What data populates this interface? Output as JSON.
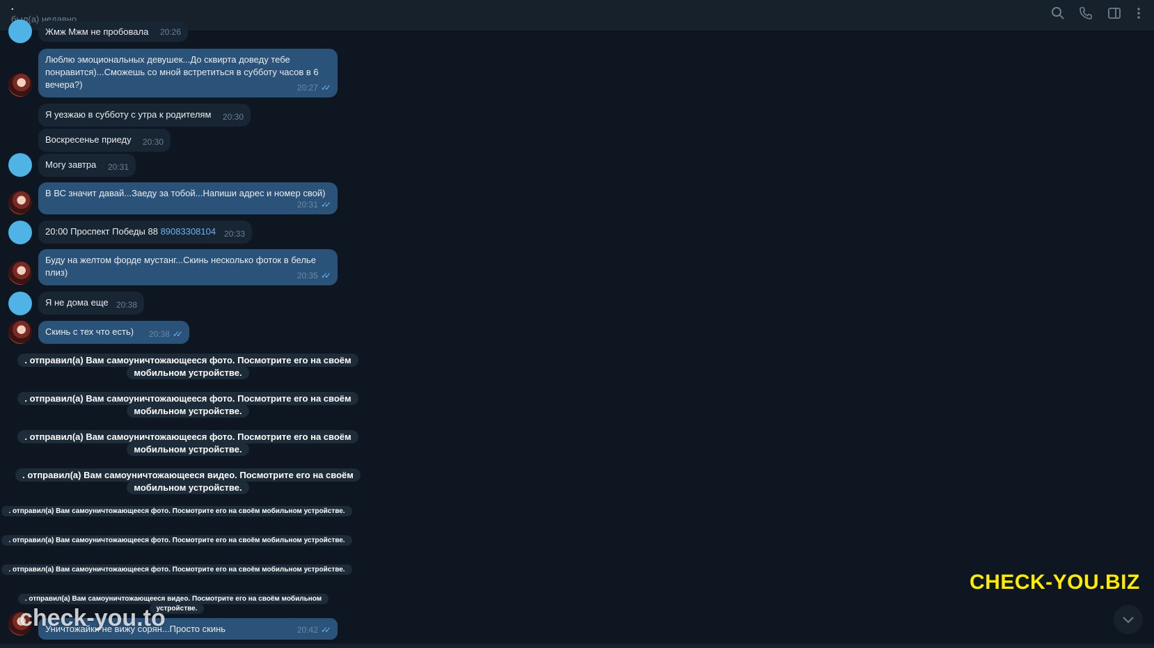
{
  "header": {
    "name": ".",
    "status": "был(а) недавно",
    "icons": [
      "search-icon",
      "phone-icon",
      "sidebar-toggle-icon",
      "more-vert-icon"
    ]
  },
  "messages": [
    {
      "text": "Жмж Мжм не пробовала",
      "time": "20:26",
      "dir": "in"
    },
    {
      "text": "Люблю эмоциональных девушек...До сквирта доведу тебе понравится)...Сможешь со мной встретиться в субботу часов в 6 вечера?)",
      "time": "20:27",
      "dir": "out"
    },
    {
      "text": "Я уезжаю в субботу с утра к родителям",
      "time": "20:30",
      "dir": "in"
    },
    {
      "text": "Воскресенье приеду",
      "time": "20:30",
      "dir": "in"
    },
    {
      "text": "Могу завтра",
      "time": "20:31",
      "dir": "in"
    },
    {
      "text": "В ВС значит давай...Заеду за тобой...Напиши адрес и номер свой)",
      "time": "20:31",
      "dir": "out"
    },
    {
      "text": "20:00  Проспект Победы 88",
      "phone": "89083308104",
      "time": "20:33",
      "dir": "in"
    },
    {
      "text": "Буду на желтом форде мустанг...Скинь несколько фоток в белье плиз)",
      "time": "20:35",
      "dir": "out"
    },
    {
      "text": "Я не дома еще",
      "time": "20:38",
      "dir": "in"
    },
    {
      "text": "Скинь с тех что есть)",
      "time": "20:38",
      "dir": "out"
    },
    {
      "text": "Уничтожайки не вижу сорян...Просто скинь",
      "time": "20:42",
      "dir": "out"
    }
  ],
  "service": {
    "photo": ". отправил(а) Вам самоуничтожающееся фото. Посмотрите его на своём мобильном устройстве.",
    "video": ". отправил(а) Вам самоуничтожающееся видео. Посмотрите его на своём мобильном устройстве."
  },
  "watermarks": {
    "top_right": "CHECK-YOU.BIZ",
    "bottom_left": "check-you.to"
  },
  "colors": {
    "background": "#0e1621",
    "header": "#17212b",
    "incoming": "#182533",
    "outgoing": "#2b5278",
    "accent": "#6ab3f3",
    "watermark_yellow": "#ffec00"
  }
}
